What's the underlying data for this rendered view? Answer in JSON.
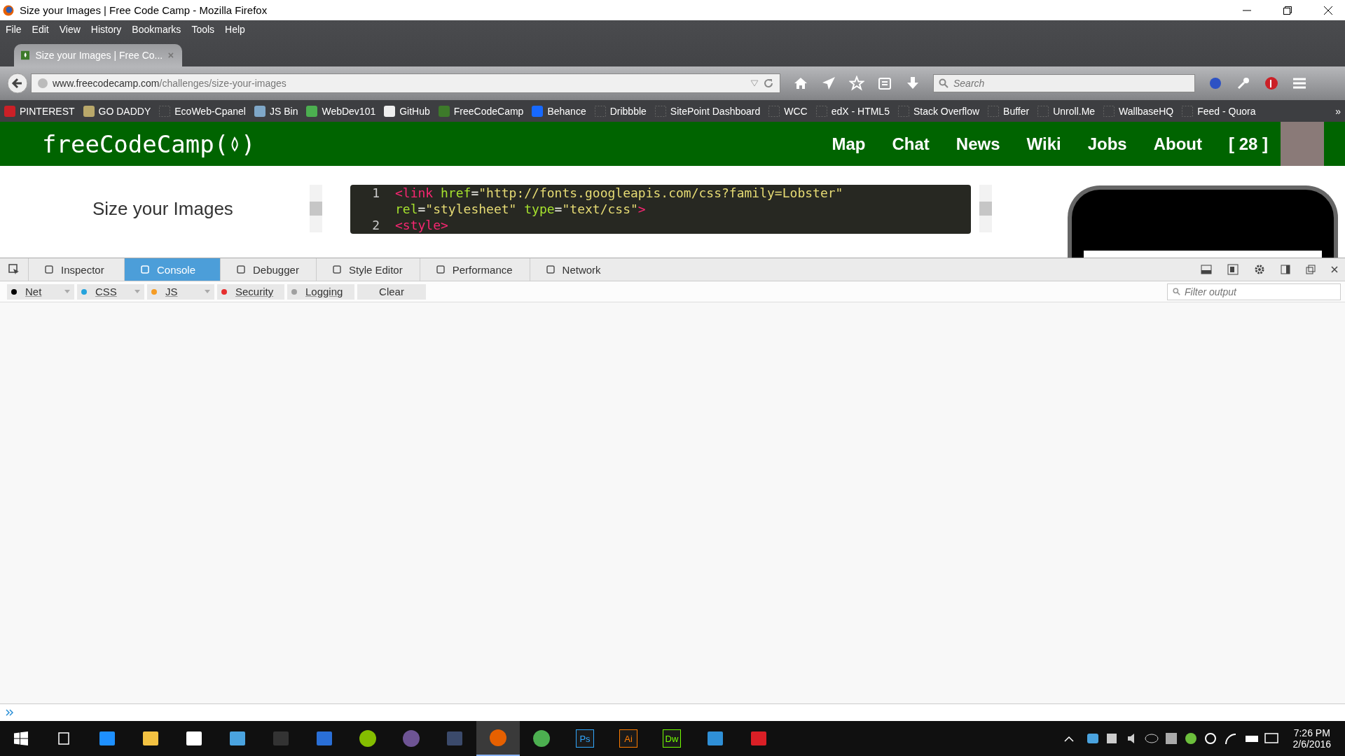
{
  "window": {
    "title": "Size your Images | Free Code Camp - Mozilla Firefox"
  },
  "menu": [
    "File",
    "Edit",
    "View",
    "History",
    "Bookmarks",
    "Tools",
    "Help"
  ],
  "tab": {
    "title": "Size your Images | Free Co..."
  },
  "address": {
    "domain": "www.freecodecamp.com",
    "path": "/challenges/size-your-images"
  },
  "search": {
    "placeholder": "Search"
  },
  "bookmarks": [
    {
      "label": "PINTEREST",
      "kind": "pin"
    },
    {
      "label": "GO DADDY",
      "kind": "figure"
    },
    {
      "label": "EcoWeb-Cpanel",
      "kind": "blank"
    },
    {
      "label": "JS Bin",
      "kind": "bin"
    },
    {
      "label": "WebDev101",
      "kind": "green"
    },
    {
      "label": "GitHub",
      "kind": "cat"
    },
    {
      "label": "FreeCodeCamp",
      "kind": "fire"
    },
    {
      "label": "Behance",
      "kind": "blue"
    },
    {
      "label": "Dribbble",
      "kind": "blank"
    },
    {
      "label": "SitePoint Dashboard",
      "kind": "blank"
    },
    {
      "label": "WCC",
      "kind": "blank"
    },
    {
      "label": "edX - HTML5",
      "kind": "blank"
    },
    {
      "label": "Stack Overflow",
      "kind": "blank"
    },
    {
      "label": "Buffer",
      "kind": "blank"
    },
    {
      "label": "Unroll.Me",
      "kind": "blank"
    },
    {
      "label": "WallbaseHQ",
      "kind": "blank"
    },
    {
      "label": "Feed - Quora",
      "kind": "blank"
    }
  ],
  "bookmarks_more": "»",
  "site": {
    "logo": "freeCodeCamp(",
    "logo_end": ")",
    "nav": [
      "Map",
      "Chat",
      "News",
      "Wiki",
      "Jobs",
      "About"
    ],
    "points": "[ 28 ]"
  },
  "challenge": {
    "title": "Size your Images"
  },
  "code_lines": [
    {
      "number": "1",
      "tokens": [
        {
          "text": "<link ",
          "kind": "tag"
        },
        {
          "text": "href",
          "kind": "attr"
        },
        {
          "text": "=",
          "kind": "plain"
        },
        {
          "text": "\"http://fonts.googleapis.com/css?family=Lobster\"",
          "kind": "string"
        }
      ]
    },
    {
      "tokens": [
        {
          "text": "rel",
          "kind": "attr"
        },
        {
          "text": "=",
          "kind": "plain"
        },
        {
          "text": "\"stylesheet\" ",
          "kind": "string"
        },
        {
          "text": "type",
          "kind": "attr"
        },
        {
          "text": "=",
          "kind": "plain"
        },
        {
          "text": "\"text/css\"",
          "kind": "string"
        },
        {
          "text": ">",
          "kind": "tag"
        }
      ]
    },
    {
      "number": "2",
      "tokens": [
        {
          "text": "<style>",
          "kind": "tag"
        }
      ]
    }
  ],
  "devtools": {
    "tabs": [
      {
        "label": "Inspector",
        "selected": false
      },
      {
        "label": "Console",
        "selected": true
      },
      {
        "label": "Debugger",
        "selected": false
      },
      {
        "label": "Style Editor",
        "selected": false
      },
      {
        "label": "Performance",
        "selected": false
      },
      {
        "label": "Network",
        "selected": false
      }
    ],
    "filters": [
      {
        "label": "Net",
        "color": "#000000"
      },
      {
        "label": "CSS",
        "color": "#26a3dc"
      },
      {
        "label": "JS",
        "color": "#f59c25"
      },
      {
        "label": "Security",
        "color": "#e62e2e"
      },
      {
        "label": "Logging",
        "color": "#a0a0a0"
      }
    ],
    "clear": "Clear",
    "filter_placeholder": "Filter output"
  },
  "taskbar": {
    "apps": [
      {
        "kind": "edge",
        "selected": false
      },
      {
        "kind": "folder",
        "selected": false
      },
      {
        "kind": "store",
        "selected": false
      },
      {
        "kind": "card",
        "selected": false
      },
      {
        "kind": "terminal",
        "selected": false
      },
      {
        "kind": "shell",
        "selected": false
      },
      {
        "kind": "music",
        "selected": false
      },
      {
        "kind": "cat",
        "selected": false
      },
      {
        "kind": "hex",
        "selected": false
      },
      {
        "kind": "fox",
        "selected": true
      },
      {
        "kind": "chrome",
        "selected": false
      },
      {
        "kind": "badge",
        "label": "Ps",
        "color": "#31a8ff",
        "selected": false
      },
      {
        "kind": "badge",
        "label": "Ai",
        "color": "#ff7c00",
        "selected": false
      },
      {
        "kind": "badge",
        "label": "Dw",
        "color": "#72ff00",
        "selected": false
      },
      {
        "kind": "brackets",
        "selected": false
      },
      {
        "kind": "cloud",
        "selected": false
      }
    ],
    "time": "7:26 PM",
    "date": "2/6/2016"
  }
}
